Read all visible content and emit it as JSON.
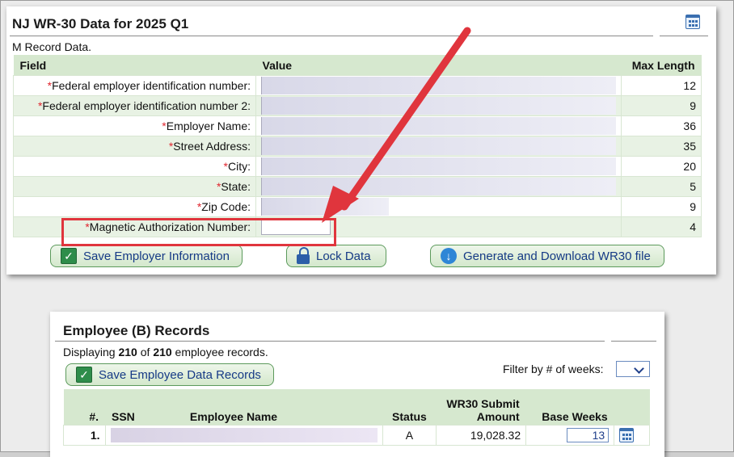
{
  "m_panel": {
    "title": "NJ WR-30 Data for 2025 Q1",
    "subtitle": "M Record Data.",
    "columns": {
      "field": "Field",
      "value": "Value",
      "max": "Max Length"
    },
    "rows": [
      {
        "label": "Federal employer identification number:",
        "max": "12"
      },
      {
        "label": "Federal employer identification number 2:",
        "max": "9"
      },
      {
        "label": "Employer Name:",
        "max": "36"
      },
      {
        "label": "Street Address:",
        "max": "35"
      },
      {
        "label": "City:",
        "max": "20"
      },
      {
        "label": "State:",
        "max": "5"
      },
      {
        "label": "Zip Code:",
        "max": "9"
      },
      {
        "label": "Magnetic Authorization Number:",
        "max": "4"
      }
    ],
    "required_mark": "*",
    "buttons": {
      "save": "Save Employer Information",
      "lock": "Lock Data",
      "generate": "Generate and Download WR30 file"
    }
  },
  "b_panel": {
    "title": "Employee (B) Records",
    "display_prefix": "Displaying ",
    "display_shown": "210",
    "display_of": " of ",
    "display_total": "210",
    "display_suffix": " employee records.",
    "save_button": "Save Employee Data Records",
    "filter_label": "Filter by # of weeks:",
    "columns": {
      "num": "#.",
      "ssn": "SSN",
      "name": "Employee Name",
      "status": "Status",
      "amount_line1": "WR30 Submit",
      "amount_line2": "Amount",
      "weeks": "Base Weeks"
    },
    "rows": [
      {
        "num": "1.",
        "status": "A",
        "amount": "19,028.32",
        "weeks": "13"
      }
    ]
  },
  "colors": {
    "accent_red": "#e0353d",
    "header_green": "#d6e8cf",
    "link_blue": "#163a86"
  }
}
